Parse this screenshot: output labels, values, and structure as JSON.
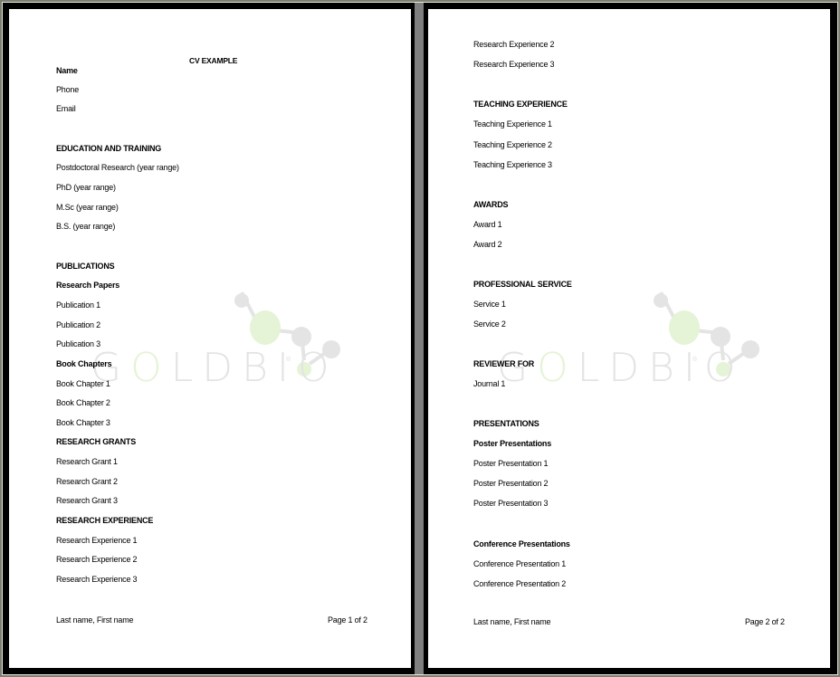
{
  "document": {
    "watermark": {
      "text_prefix": "G",
      "text_o": "O",
      "text_suffix": "LDBIO",
      "registered": "®",
      "green": "#e5f3d6",
      "gray": "#e4e4e4"
    },
    "pages": [
      {
        "title": "CV EXAMPLE",
        "lines": [
          {
            "text": "Name",
            "bold": true
          },
          {
            "text": "Phone",
            "bold": false
          },
          {
            "text": "Email",
            "bold": false
          },
          {
            "text": "EDUCATION AND TRAINING",
            "bold": true
          },
          {
            "text": "Postdoctoral Research (year range)",
            "bold": false
          },
          {
            "text": "PhD (year range)",
            "bold": false
          },
          {
            "text": "M.Sc (year range)",
            "bold": false
          },
          {
            "text": "B.S. (year range)",
            "bold": false
          },
          {
            "text": "PUBLICATIONS",
            "bold": true
          },
          {
            "text": "Research Papers",
            "bold": true
          },
          {
            "text": "Publication 1",
            "bold": false
          },
          {
            "text": "Publication 2",
            "bold": false
          },
          {
            "text": "Publication 3",
            "bold": false
          },
          {
            "text": "Book Chapters",
            "bold": true
          },
          {
            "text": "Book Chapter 1",
            "bold": false
          },
          {
            "text": "Book Chapter 2",
            "bold": false
          },
          {
            "text": "Book Chapter 3",
            "bold": false
          },
          {
            "text": "RESEARCH GRANTS",
            "bold": true
          },
          {
            "text": "Research Grant 1",
            "bold": false
          },
          {
            "text": "Research Grant 2",
            "bold": false
          },
          {
            "text": "Research Grant 3",
            "bold": false
          },
          {
            "text": "RESEARCH EXPERIENCE",
            "bold": true
          },
          {
            "text": "Research Experience 1",
            "bold": false
          },
          {
            "text": "Research Experience 2",
            "bold": false
          },
          {
            "text": "Research Experience 3",
            "bold": false
          }
        ],
        "footer_left": "Last name, First name",
        "footer_right": "Page 1 of 2"
      },
      {
        "lines": [
          {
            "text": "Research Experience 2",
            "bold": false
          },
          {
            "text": "Research Experience 3",
            "bold": false
          },
          {
            "text": "TEACHING EXPERIENCE",
            "bold": true
          },
          {
            "text": "Teaching Experience 1",
            "bold": false
          },
          {
            "text": "Teaching Experience 2",
            "bold": false
          },
          {
            "text": "Teaching Experience 3",
            "bold": false
          },
          {
            "text": "AWARDS",
            "bold": true
          },
          {
            "text": "Award 1",
            "bold": false
          },
          {
            "text": "Award 2",
            "bold": false
          },
          {
            "text": "PROFESSIONAL SERVICE",
            "bold": true
          },
          {
            "text": "Service 1",
            "bold": false
          },
          {
            "text": "Service 2",
            "bold": false
          },
          {
            "text": "REVIEWER FOR",
            "bold": true
          },
          {
            "text": "Journal 1",
            "bold": false
          },
          {
            "text": "PRESENTATIONS",
            "bold": true
          },
          {
            "text": "Poster Presentations",
            "bold": true
          },
          {
            "text": "Poster Presentation 1",
            "bold": false
          },
          {
            "text": "Poster Presentation 2",
            "bold": false
          },
          {
            "text": "Poster Presentation 3",
            "bold": false
          },
          {
            "text": "Conference Presentations",
            "bold": true
          },
          {
            "text": "Conference Presentation 1",
            "bold": false
          },
          {
            "text": "Conference Presentation 2",
            "bold": false
          }
        ],
        "footer_left": "Last name, First name",
        "footer_right": "Page 2 of 2"
      }
    ]
  }
}
